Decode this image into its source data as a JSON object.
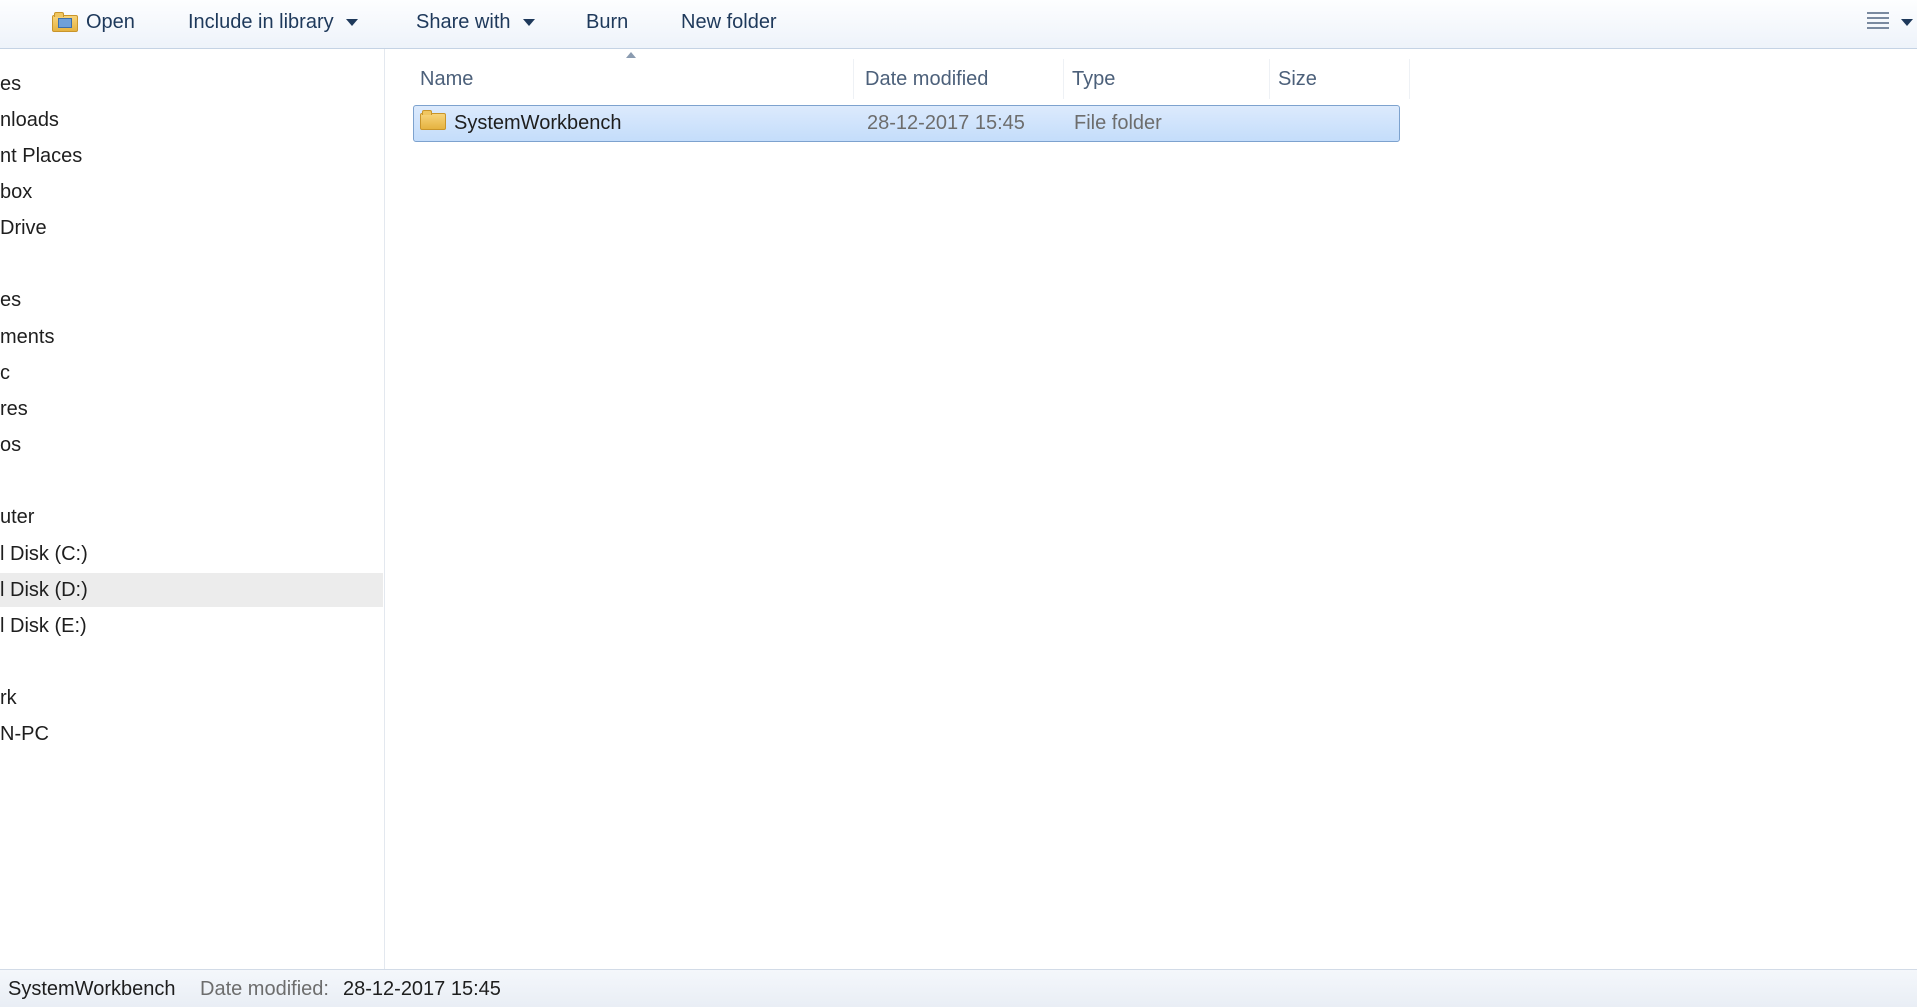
{
  "toolbar": {
    "open_label": "Open",
    "include_label": "Include in library",
    "share_label": "Share with",
    "burn_label": "Burn",
    "new_folder_label": "New folder"
  },
  "nav": {
    "items": [
      {
        "label": "es"
      },
      {
        "label": "nloads"
      },
      {
        "label": "nt Places"
      },
      {
        "label": "box"
      },
      {
        "label": "Drive"
      },
      {
        "label": "es"
      },
      {
        "label": "ments"
      },
      {
        "label": "c"
      },
      {
        "label": "res"
      },
      {
        "label": "os"
      },
      {
        "label": "uter"
      },
      {
        "label": "l Disk (C:)"
      },
      {
        "label": "l Disk (D:)",
        "selected": true
      },
      {
        "label": "l Disk (E:)"
      },
      {
        "label": "rk"
      },
      {
        "label": "N-PC"
      }
    ]
  },
  "columns": {
    "name": "Name",
    "date": "Date modified",
    "type": "Type",
    "size": "Size"
  },
  "files": [
    {
      "name": "SystemWorkbench",
      "date": "28-12-2017 15:45",
      "type": "File folder",
      "size": ""
    }
  ],
  "status": {
    "name": "SystemWorkbench",
    "date_label": "Date modified:",
    "date_value": "28-12-2017 15:45"
  },
  "colors": {
    "selection": "#cce1fb",
    "toolbar_text": "#1e395b"
  }
}
